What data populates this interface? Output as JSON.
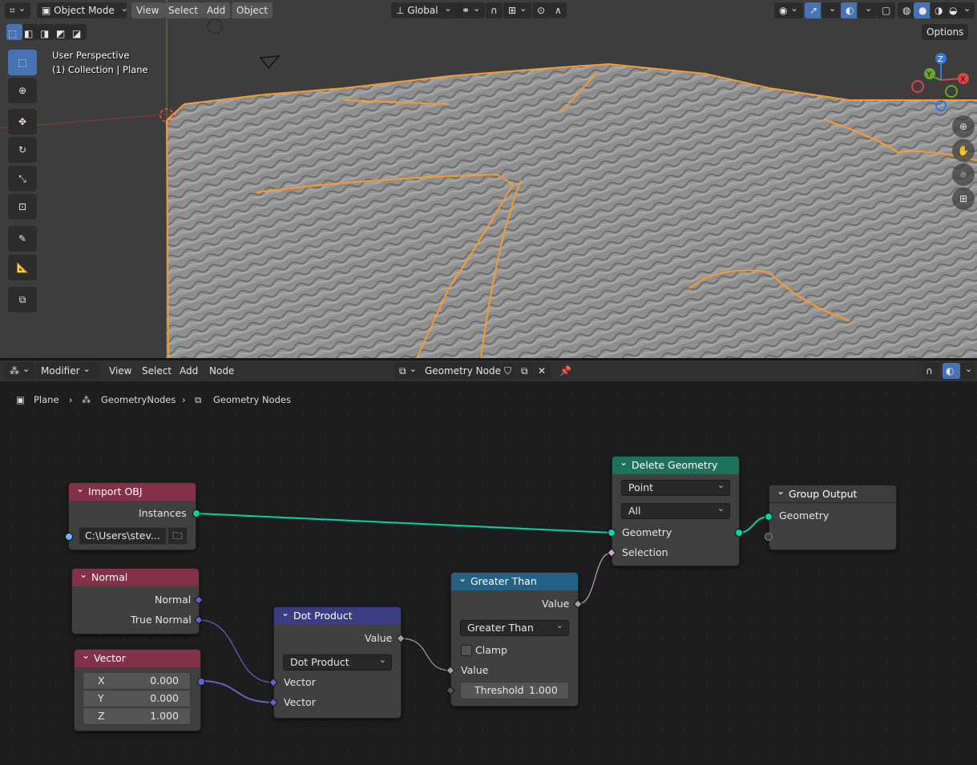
{
  "viewport": {
    "header": {
      "mode": "Object Mode",
      "menus": [
        "View",
        "Select",
        "Add",
        "Object"
      ],
      "orientation": "Global",
      "options": "Options"
    },
    "overlay": {
      "perspective": "User Perspective",
      "collection": "(1) Collection | Plane"
    },
    "gizmo": {
      "z": "Z",
      "y": "Y",
      "x": "X"
    },
    "colors": {
      "selection_outline": "#f59b32",
      "active_tool": "#4772b3"
    }
  },
  "node_editor": {
    "header": {
      "editor_type": "Modifier",
      "menus": [
        "View",
        "Select",
        "Add",
        "Node"
      ],
      "tree_name": "Geometry Nodes"
    },
    "breadcrumb": [
      "Plane",
      "GeometryNodes",
      "Geometry Nodes"
    ],
    "nodes": {
      "import_obj": {
        "title": "Import OBJ",
        "output": "Instances",
        "path": "C:\\Users\\stev..."
      },
      "normal": {
        "title": "Normal",
        "outputs": [
          "Normal",
          "True Normal"
        ]
      },
      "vector": {
        "title": "Vector",
        "x_label": "X",
        "x": "0.000",
        "y_label": "Y",
        "y": "0.000",
        "z_label": "Z",
        "z": "1.000"
      },
      "dot_product": {
        "title": "Dot Product",
        "output": "Value",
        "operation": "Dot Product",
        "inputs": [
          "Vector",
          "Vector"
        ]
      },
      "greater_than": {
        "title": "Greater Than",
        "output": "Value",
        "operation": "Greater Than",
        "clamp": "Clamp",
        "input": "Value",
        "threshold_label": "Threshold",
        "threshold": "1.000"
      },
      "delete_geometry": {
        "title": "Delete Geometry",
        "domain": "Point",
        "mode": "All",
        "inputs": [
          "Geometry",
          "Selection"
        ]
      },
      "group_output": {
        "title": "Group Output",
        "input": "Geometry"
      }
    }
  }
}
